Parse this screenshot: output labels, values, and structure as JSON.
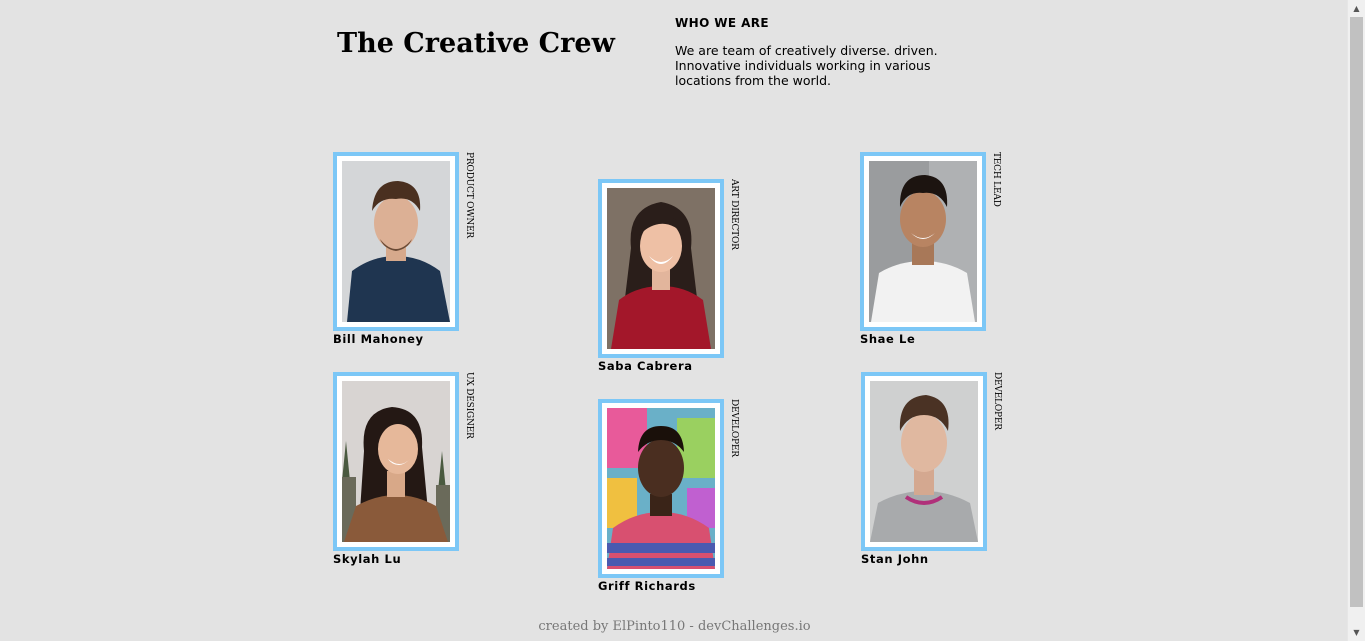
{
  "header": {
    "title": "The Creative Crew",
    "about_heading": "WHO WE ARE",
    "about_text": "We are team of creatively diverse. driven. Innovative individuals working in various locations from the world."
  },
  "accent_color": "#7cc7f6",
  "members": [
    {
      "name": "Bill Mahoney",
      "role": "PRODUCT OWNER"
    },
    {
      "name": "Saba Cabrera",
      "role": "ART DIRECTOR"
    },
    {
      "name": "Shae Le",
      "role": "TECH LEAD"
    },
    {
      "name": "Skylah Lu",
      "role": "UX DESIGNER"
    },
    {
      "name": "Griff Richards",
      "role": "DEVELOPER"
    },
    {
      "name": "Stan John",
      "role": "DEVELOPER"
    }
  ],
  "footer": {
    "text": "created by ElPinto110 - devChallenges.io"
  }
}
